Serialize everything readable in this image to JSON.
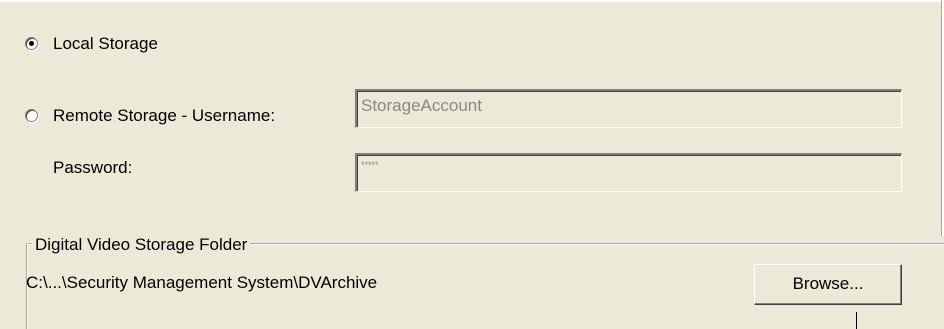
{
  "storage": {
    "local_label": "Local Storage",
    "local_selected": true,
    "remote_label": "Remote Storage - Username:",
    "remote_selected": false,
    "username_value": "StorageAccount",
    "password_label": "Password:",
    "password_value": "*****"
  },
  "folder_group": {
    "title": "Digital Video Storage Folder",
    "path": "C:\\...\\Security Management System\\DVArchive",
    "browse_label": "Browse..."
  }
}
